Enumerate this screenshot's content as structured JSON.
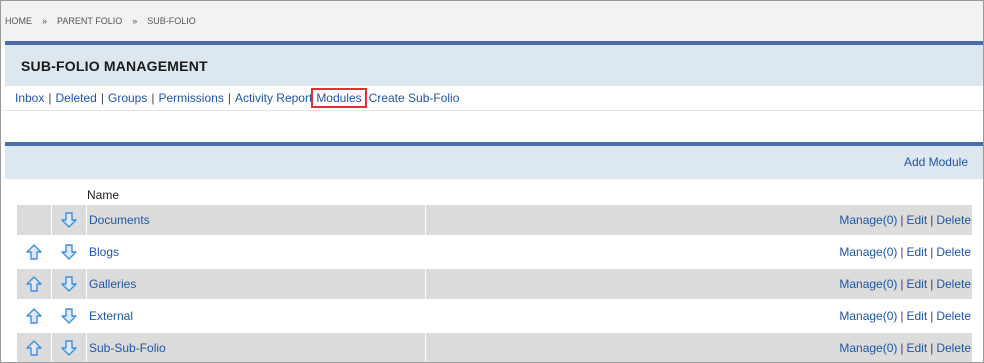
{
  "breadcrumb": {
    "items": [
      "HOME",
      "PARENT FOLIO",
      "SUB-FOLIO"
    ],
    "separator": "»"
  },
  "header": {
    "title": "SUB-FOLIO MANAGEMENT"
  },
  "nav": {
    "links": [
      "Inbox",
      "Deleted",
      "Groups",
      "Permissions",
      "Activity Report",
      "Modules",
      "Create Sub-Folio"
    ],
    "separator": "|"
  },
  "modules": {
    "add_label": "Add Module",
    "column_name": "Name",
    "rows": [
      {
        "name": "Documents",
        "manage": "Manage(0)",
        "edit": "Edit",
        "delete": "Delete"
      },
      {
        "name": "Blogs",
        "manage": "Manage(0)",
        "edit": "Edit",
        "delete": "Delete"
      },
      {
        "name": "Galleries",
        "manage": "Manage(0)",
        "edit": "Edit",
        "delete": "Delete"
      },
      {
        "name": "External",
        "manage": "Manage(0)",
        "edit": "Edit",
        "delete": "Delete"
      },
      {
        "name": "Sub-Sub-Folio",
        "manage": "Manage(0)",
        "edit": "Edit",
        "delete": "Delete"
      }
    ],
    "action_separator": "|"
  },
  "colors": {
    "accent_bar": "#4a6ea9",
    "panel_bg": "#dce7f0",
    "link": "#1f55a6",
    "highlight_border": "#e03232",
    "arrow_icon": "#3d8fe0"
  },
  "icons": {
    "move_up": "arrow-up-icon",
    "move_down": "arrow-down-icon"
  }
}
